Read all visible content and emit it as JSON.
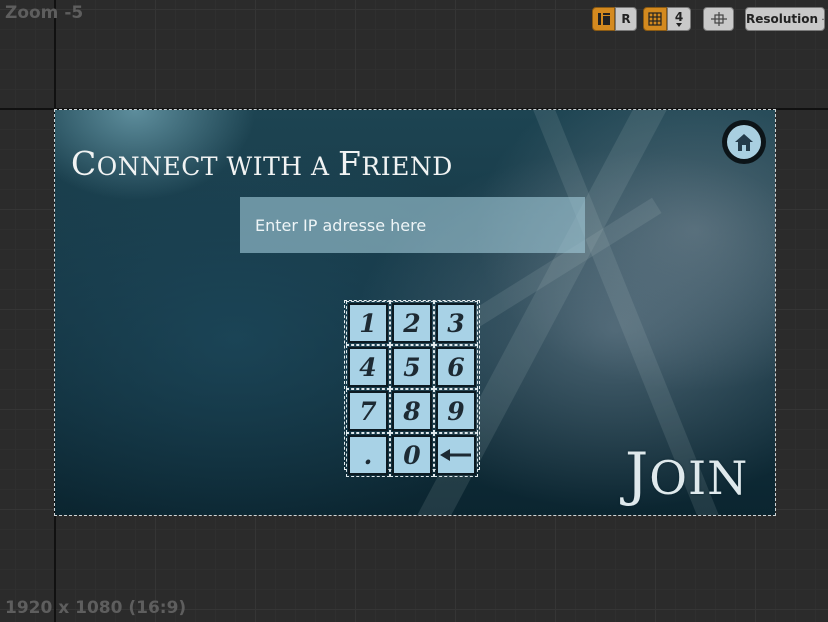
{
  "viewport": {
    "zoom_label": "Zoom -5",
    "resolution_info": "1920 x 1080 (16:9)"
  },
  "toolbar": {
    "r_label": "R",
    "grid_value": "4",
    "resolution_label": "Resolution",
    "icons": [
      "layout-icon",
      "grid-icon",
      "transform-icon",
      "chevron-down-icon"
    ]
  },
  "widget": {
    "title_first": "C",
    "title_rest": "ONNECT WITH A ",
    "title_f": "F",
    "title_end": "RIEND",
    "ip_placeholder": "Enter IP adresse here",
    "keypad_keys": [
      "1",
      "2",
      "3",
      "4",
      "5",
      "6",
      "7",
      "8",
      "9",
      ".",
      "0",
      "←"
    ],
    "join_first": "J",
    "join_rest": "OIN",
    "icons": [
      "home-icon",
      "backspace-arrow-icon"
    ]
  },
  "colors": {
    "accent_orange": "#d48a1f",
    "key_fill": "#a8d2e6",
    "input_fill": "#a0c8d7",
    "background_teal": "#163745"
  }
}
